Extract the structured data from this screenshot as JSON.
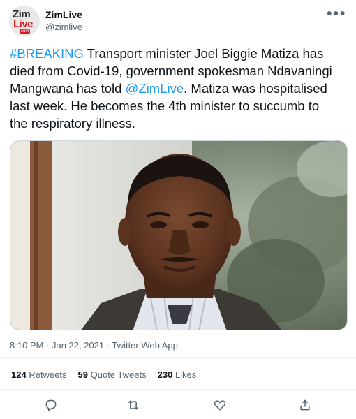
{
  "author": {
    "display_name": "ZimLive",
    "handle": "@zimlive",
    "avatar_line1": "Zim",
    "avatar_line2": "Live",
    "avatar_line3": "com"
  },
  "tweet": {
    "hashtag": "#BREAKING",
    "text_part1": " Transport minister Joel Biggie Matiza has died from Covid-19, government spokesman Ndavaningi Mangwana has told ",
    "mention": "@ZimLive",
    "text_part2": ". Matiza was hospitalised last week. He becomes the 4th minister to succumb to the respiratory illness."
  },
  "meta": {
    "timestamp": "8:10 PM · Jan 22, 2021 · Twitter Web App"
  },
  "stats": {
    "retweets_count": "124",
    "retweets_label": "Retweets",
    "quotes_count": "59",
    "quotes_label": "Quote Tweets",
    "likes_count": "230",
    "likes_label": "Likes"
  },
  "icons": {
    "reply": "reply-icon",
    "retweet": "retweet-icon",
    "like": "heart-icon",
    "share": "share-icon",
    "more": "more-icon"
  },
  "colors": {
    "accent": "#1d9bf0",
    "brand_red": "#d8191f"
  }
}
